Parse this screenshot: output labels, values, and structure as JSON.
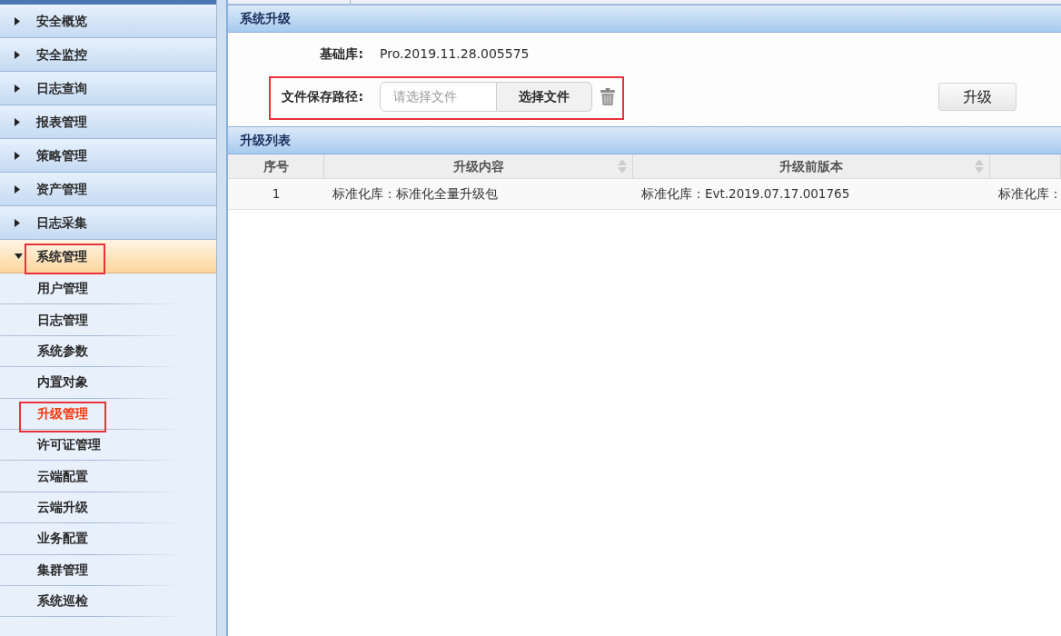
{
  "sidebar": {
    "items": [
      {
        "label": "安全概览",
        "expanded": false,
        "highlighted": false
      },
      {
        "label": "安全监控",
        "expanded": false,
        "highlighted": false
      },
      {
        "label": "日志查询",
        "expanded": false,
        "highlighted": false
      },
      {
        "label": "报表管理",
        "expanded": false,
        "highlighted": false
      },
      {
        "label": "策略管理",
        "expanded": false,
        "highlighted": false
      },
      {
        "label": "资产管理",
        "expanded": false,
        "highlighted": false
      },
      {
        "label": "日志采集",
        "expanded": false,
        "highlighted": false
      },
      {
        "label": "系统管理",
        "expanded": true,
        "highlighted": true,
        "children": [
          {
            "label": "用户管理",
            "selected": false,
            "highlighted": false
          },
          {
            "label": "日志管理",
            "selected": false,
            "highlighted": false
          },
          {
            "label": "系统参数",
            "selected": false,
            "highlighted": false
          },
          {
            "label": "内置对象",
            "selected": false,
            "highlighted": false
          },
          {
            "label": "升级管理",
            "selected": true,
            "highlighted": true
          },
          {
            "label": "许可证管理",
            "selected": false,
            "highlighted": false
          },
          {
            "label": "云端配置",
            "selected": false,
            "highlighted": false
          },
          {
            "label": "云端升级",
            "selected": false,
            "highlighted": false
          },
          {
            "label": "业务配置",
            "selected": false,
            "highlighted": false
          },
          {
            "label": "集群管理",
            "selected": false,
            "highlighted": false
          },
          {
            "label": "系统巡检",
            "selected": false,
            "highlighted": false
          }
        ]
      }
    ]
  },
  "upgrade_panel": {
    "title": "系统升级",
    "base_library": {
      "label": "基础库:",
      "value": "Pro.2019.11.28.005575"
    },
    "file_path": {
      "label": "文件保存路径:",
      "placeholder": "请选择文件",
      "button": "选择文件",
      "highlighted": true
    },
    "upgrade_button": "升级"
  },
  "list_panel": {
    "title": "升级列表",
    "table": {
      "columns": [
        {
          "label": "序号",
          "sortable": false
        },
        {
          "label": "升级内容",
          "sortable": true
        },
        {
          "label": "升级前版本",
          "sortable": true
        }
      ],
      "rows": [
        {
          "cells": [
            "1",
            "标准化库：标准化全量升级包",
            "标准化库：Evt.2019.07.17.001765",
            "标准化库："
          ]
        }
      ]
    }
  }
}
